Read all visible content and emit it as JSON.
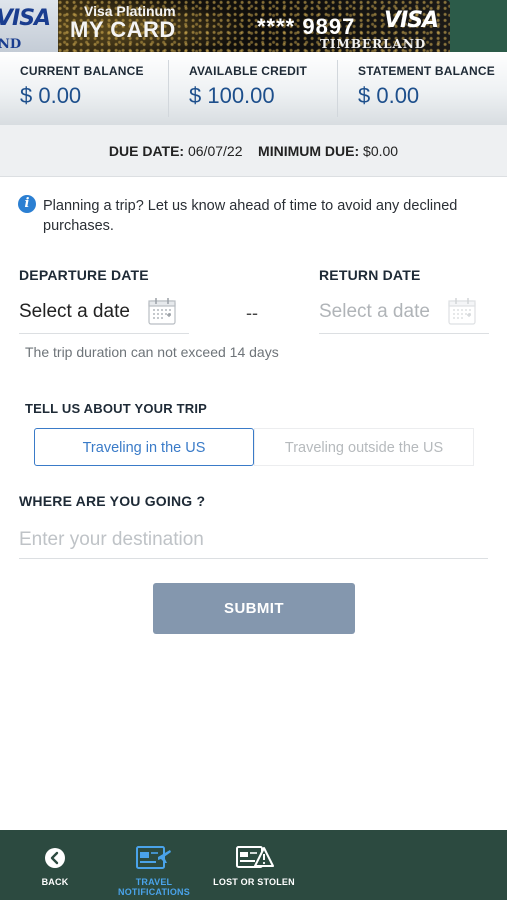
{
  "card": {
    "prev_brand": "VISA",
    "prev_issuer_fragment": "ND",
    "tier": "Visa Platinum",
    "name": "MY CARD",
    "number_masked": "**** 9897",
    "brand": "VISA",
    "issuer": "TIMBERLAND"
  },
  "balances": [
    {
      "label": "CURRENT BALANCE",
      "value": "$ 0.00"
    },
    {
      "label": "AVAILABLE CREDIT",
      "value": "$ 100.00"
    },
    {
      "label": "STATEMENT BALANCE",
      "value": "$ 0.00"
    }
  ],
  "due": {
    "due_date_label": "DUE DATE:",
    "due_date_value": "06/07/22",
    "minimum_due_label": "MINIMUM DUE:",
    "minimum_due_value": "$0.00"
  },
  "info": {
    "icon": "info-circle-icon",
    "message": "Planning a trip? Let us know ahead of time to avoid any declined purchases."
  },
  "dates": {
    "departure_label": "DEPARTURE DATE",
    "departure_placeholder": "Select a date",
    "separator": "--",
    "return_label": "RETURN DATE",
    "return_placeholder": "Select a date",
    "hint": "The trip duration can not exceed 14 days"
  },
  "trip": {
    "label": "TELL US ABOUT YOUR TRIP",
    "options": [
      "Traveling in the US",
      "Traveling outside the US"
    ],
    "selected": "Traveling in the US"
  },
  "destination": {
    "label": "WHERE ARE YOU GOING ?",
    "placeholder": "Enter your destination",
    "value": ""
  },
  "submit_label": "SUBMIT",
  "bottom_nav": [
    {
      "label": "BACK",
      "icon": "back-arrow-icon",
      "active": false
    },
    {
      "label": "TRAVEL NOTIFICATIONS",
      "icon": "travel-notifications-icon",
      "active": true
    },
    {
      "label": "LOST OR STOLEN",
      "icon": "lost-or-stolen-icon",
      "active": false
    }
  ],
  "colors": {
    "accent": "#1d4f8c",
    "active_tab": "#3a7bc8",
    "nav_bg": "#2c4a40",
    "submit_bg": "#8497ae",
    "nav_active_text": "#4aa3ea"
  }
}
